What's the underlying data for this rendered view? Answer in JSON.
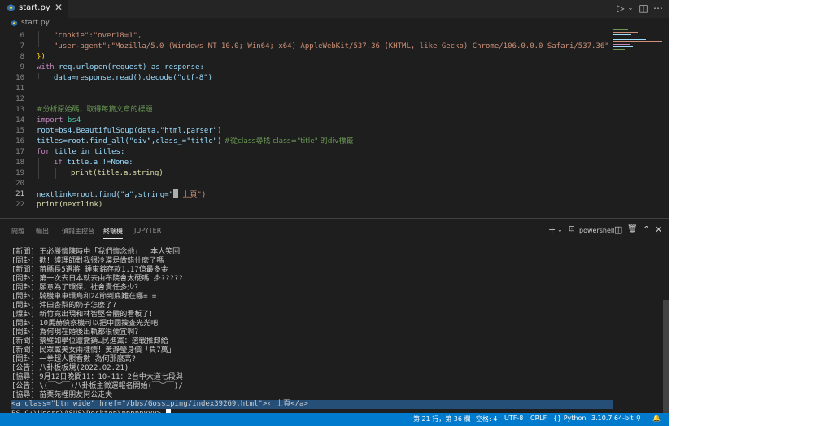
{
  "tab": {
    "filename": "start.py",
    "close": "✕"
  },
  "breadcrumb": {
    "file": "start.py",
    "sep": "›"
  },
  "editor": {
    "lines": [
      {
        "n": "6"
      },
      {
        "n": "7"
      },
      {
        "n": "8"
      },
      {
        "n": "9"
      },
      {
        "n": "10"
      },
      {
        "n": "11"
      },
      {
        "n": "12"
      },
      {
        "n": "13"
      },
      {
        "n": "14"
      },
      {
        "n": "15"
      },
      {
        "n": "16"
      },
      {
        "n": "17"
      },
      {
        "n": "18"
      },
      {
        "n": "19"
      },
      {
        "n": "20"
      },
      {
        "n": "21"
      },
      {
        "n": "22"
      }
    ],
    "current_line": "21",
    "code": {
      "l6": "\"cookie\":\"over18=1\",",
      "l7": "\"user-agent\":\"Mozilla/5.0 (Windows NT 10.0; Win64; x64) AppleWebKit/537.36 (KHTML, like Gecko) Chrome/106.0.0.0 Safari/537.36\"",
      "l8": "})",
      "l9_kw": "with",
      "l9_rest": " req.urlopen(request) as response:",
      "l10": "data=response.read().decode(\"utf-8\")",
      "l13": "#分析原始碼，取得每篇文章的標題",
      "l14_kw": "import",
      "l14_rest": " bs4",
      "l15": "root=bs4.BeautifulSoup(data,\"html.parser\")",
      "l16": "titles=root.find_all(\"div\",class_=\"title\")",
      "l16_cm": " #從class尋找 class=\"title\" 的div標籤",
      "l17_kw": "for",
      "l17_rest": " title in titles:",
      "l18_kw": "if",
      "l18_rest": " title.a !=None:",
      "l19": "print(title.a.string)",
      "l21_a": "nextlink=root.find(\"a\",string=\"",
      "l21_b": " 上頁\")",
      "l22": "print(nextlink)"
    }
  },
  "panel": {
    "tabs": [
      "問題",
      "輸出",
      "偵錯主控台",
      "終端機",
      "JUPYTER"
    ],
    "active_tab": "終端機",
    "shell": "powershell",
    "icons": {
      "add": "+",
      "dropdown": "⌄",
      "split": "◫",
      "trash": "🗑",
      "maximize": "^",
      "close": "✕"
    }
  },
  "terminal": {
    "lines": [
      "[新聞] 王必勝懷陳時中「我們懷念他」  本人笑回",
      "[問卦] 勸！護理師對我很冷漠是做錯什麼了嗎",
      "[新聞] 苗縣長5選將 鍾東錦存款1.17億最多金",
      "[問卦] 第一次去日本就去由布院會太硬嗎 掛?????",
      "[問卦] 願意為了環保，社會責任多少？",
      "[問卦] 騎機車車環島和24節到底難在哪= =",
      "[問卦] 沖田杏梨的奶子怎麼了？",
      "[爆卦] 新竹竟出現和林智堅合體的看板了！",
      "[問卦] 10馬赫偵察機可以把中國搜查光光吧",
      "[問卦] 為何現在婚後出軌都很便宜啊？",
      "[新聞] 蔡璧如學位遭撤銷…民進黨：選戰推卸給",
      "[新聞] 民眾黨美女兩樣情！黃瀞瑩身價「負7萬」",
      "[問卦] 一拳超人觀看數 為何那麼高?",
      "[公告] 八卦板板規(2022.02.21)",
      "[協尋] 9月12日晚間11：10-11：2台中大道七段與",
      "[公告] \\(￣︶￣)八卦板主徵選報名開始(￣︶￣)/",
      "[協尋] 苗栗苑裡朋友阿公走失"
    ],
    "selected_line": "<a class=\"btn wide\" href=\"/bbs/Gossiping/index39269.html\">‹ 上頁</a>",
    "prompt": "PS C:\\Users\\ASUS\\Desktop\\pppppyyy>"
  },
  "status": {
    "position": "第 21 行，第 36 欄",
    "spaces": "空格: 4",
    "encoding": "UTF-8",
    "eol": "CRLF",
    "language": "Python",
    "interpreter": "3.10.7 64-bit",
    "colors": {
      "bar": "#007acc"
    }
  }
}
